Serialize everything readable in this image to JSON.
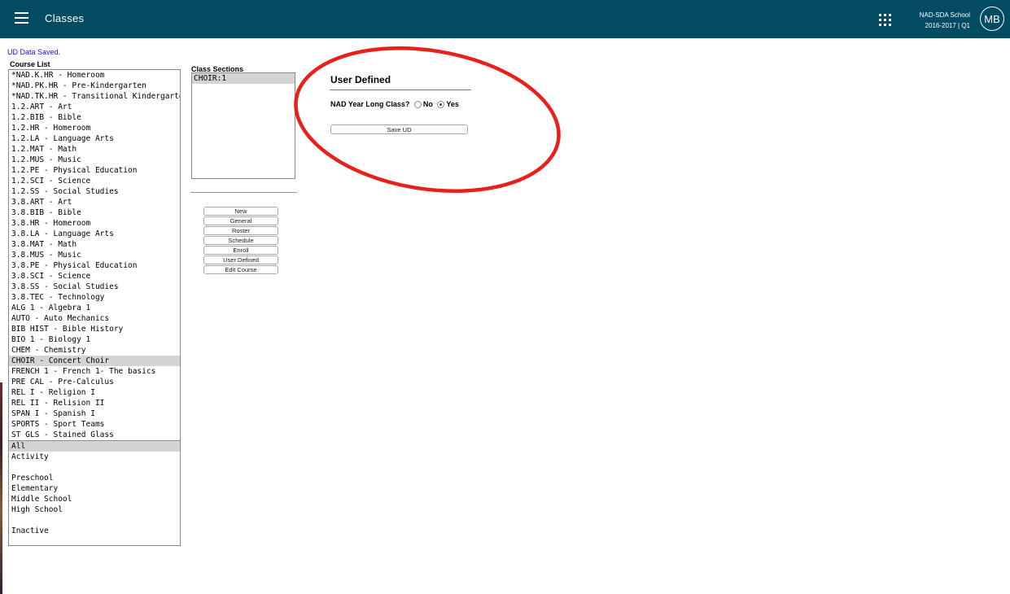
{
  "header": {
    "title": "Classes",
    "school_name": "NAD-SDA School",
    "term": "2016-2017 | Q1",
    "user_initials": "MB"
  },
  "status_message": "UD Data Saved.",
  "course_list": {
    "label": "Course List",
    "courses": [
      "*NAD.K.HR - Homeroom",
      "*NAD.PK.HR - Pre-Kindergarten",
      "*NAD.TK.HR - Transitional Kindergarten",
      "1.2.ART - Art",
      "1.2.BIB - Bible",
      "1.2.HR - Homeroom",
      "1.2.LA - Language Arts",
      "1.2.MAT - Math",
      "1.2.MUS - Music",
      "1.2.PE - Physical Education",
      "1.2.SCI - Science",
      "1.2.SS - Social Studies",
      "3.8.ART - Art",
      "3.8.BIB - Bible",
      "3.8.HR - Homeroom",
      "3.8.LA - Language Arts",
      "3.8.MAT - Math",
      "3.8.MUS - Music",
      "3.8.PE - Physical Education",
      "3.8.SCI - Science",
      "3.8.SS - Social Studies",
      "3.8.TEC - Technology",
      "ALG 1 - Algebra 1",
      "AUTO - Auto Mechanics",
      "BIB HIST - Bible History",
      "BIO 1 - Biology 1",
      "CHEM - Chemistry",
      "CHOIR - Concert Choir",
      "FRENCH 1 - French 1- The basics",
      "PRE CAL - Pre-Calculus",
      "REL I - Religion I",
      "REL II - Relision II",
      "SPAN I - Spanish I",
      "SPORTS - Sport Teams",
      "ST GLS - Stained Glass"
    ],
    "selected_course": "CHOIR - Concert Choir",
    "filters": [
      "All",
      "Activity",
      "",
      "Preschool",
      "Elementary",
      "Middle School",
      "High School",
      "",
      "Inactive"
    ],
    "selected_filter": "All"
  },
  "class_sections": {
    "label": "Class Sections",
    "items": [
      "CHOIR:1"
    ],
    "selected": "CHOIR:1"
  },
  "actions": {
    "new": "New",
    "general": "General",
    "roster": "Roster",
    "schedule": "Schedule",
    "enroll": "Enroll",
    "user_defined": "User Defined",
    "edit_course": "Edit Course"
  },
  "user_defined": {
    "title": "User Defined",
    "question": "NAD Year Long Class?",
    "option_no": "No",
    "option_yes": "Yes",
    "selected": "Yes",
    "save_label": "Save UD"
  },
  "colors": {
    "header_bg": "#034a63",
    "status_text": "#1414c8",
    "selection_bg": "#d4d4d4",
    "annotation": "#e8201a"
  }
}
